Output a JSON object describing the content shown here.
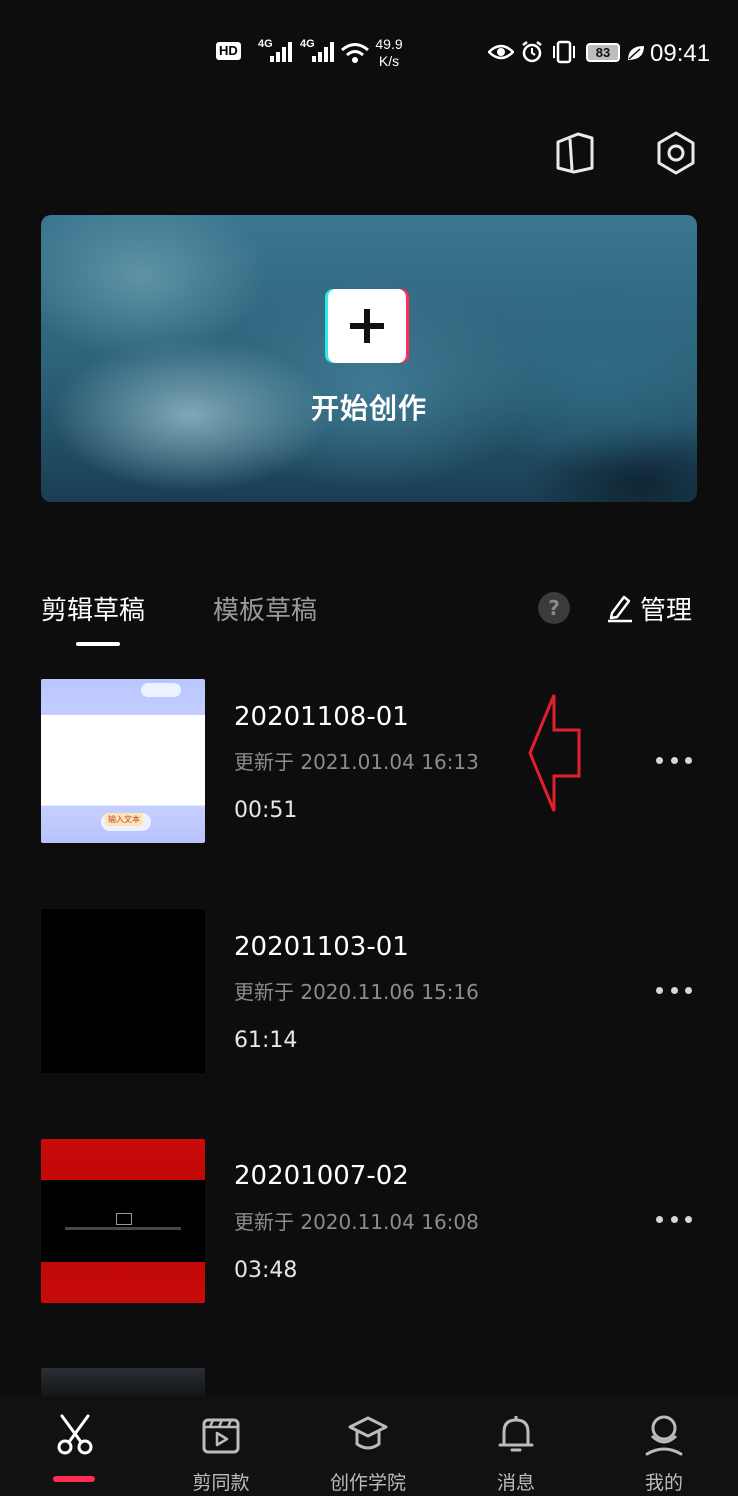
{
  "status_bar": {
    "hd": "HD",
    "signal_1": "4G",
    "signal_2": "4G",
    "speed_value": "49.9",
    "speed_unit": "K/s",
    "battery": "83",
    "time": "09:41"
  },
  "top_icons": [
    "book-icon",
    "settings-hex-icon"
  ],
  "hero": {
    "title": "开始创作",
    "icon": "plus-icon"
  },
  "tabs": {
    "active": "剪辑草稿",
    "inactive": "模板草稿",
    "help": "?",
    "manage": "管理"
  },
  "drafts": [
    {
      "title": "20201108-01",
      "updated": "更新于 2021.01.04 16:13",
      "duration": "00:51",
      "thumb_tag": "输入文本"
    },
    {
      "title": "20201103-01",
      "updated": "更新于 2020.11.06 15:16",
      "duration": "61:14"
    },
    {
      "title": "20201007-02",
      "updated": "更新于 2020.11.04 16:08",
      "duration": "03:48"
    }
  ],
  "annotation": {
    "arrow_color": "#e0202a"
  },
  "nav": {
    "items": [
      {
        "label": "",
        "icon": "scissors-icon",
        "active": true
      },
      {
        "label": "剪同款",
        "icon": "template-clapper-icon"
      },
      {
        "label": "创作学院",
        "icon": "graduation-cap-icon"
      },
      {
        "label": "消息",
        "icon": "bell-icon"
      },
      {
        "label": "我的",
        "icon": "person-icon"
      }
    ],
    "active_color": "#fe2c55"
  }
}
